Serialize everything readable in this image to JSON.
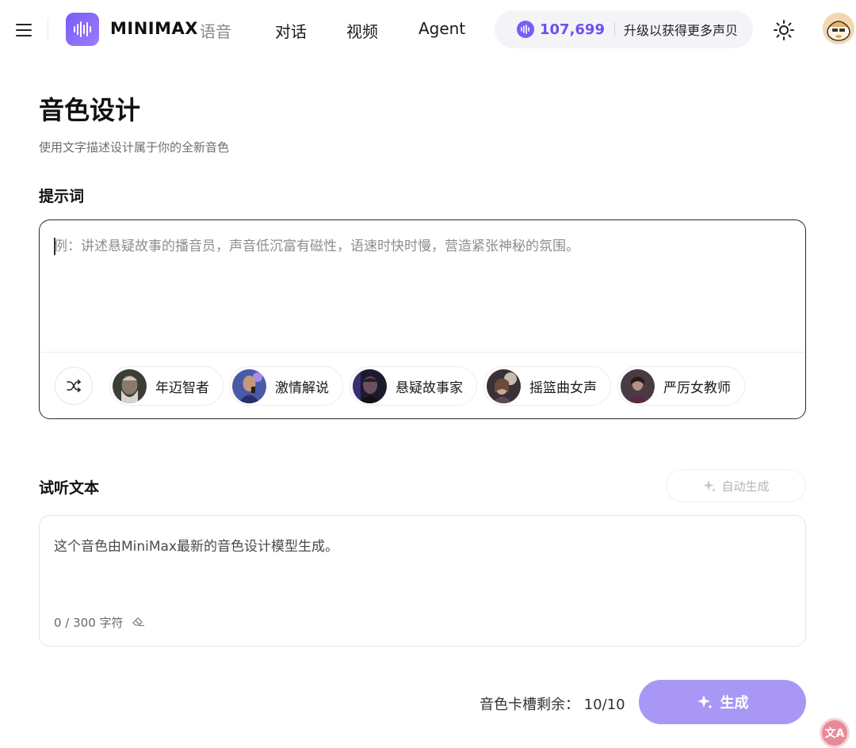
{
  "header": {
    "brand": "MINIMAX",
    "brand_sub": "语音",
    "nav": [
      {
        "label": "对话"
      },
      {
        "label": "视频"
      },
      {
        "label": "Agent"
      }
    ],
    "credits": {
      "value": "107,699",
      "upgrade_label": "升级以获得更多声贝"
    }
  },
  "page": {
    "title": "音色设计",
    "subtitle": "使用文字描述设计属于你的全新音色"
  },
  "prompt": {
    "label": "提示词",
    "placeholder": "例：讲述悬疑故事的播音员，声音低沉富有磁性，语速时快时慢，营造紧张神秘的氛围。",
    "value": "",
    "presets": [
      {
        "label": "年迈智者"
      },
      {
        "label": "激情解说"
      },
      {
        "label": "悬疑故事家"
      },
      {
        "label": "摇篮曲女声"
      },
      {
        "label": "严厉女教师"
      }
    ]
  },
  "preview": {
    "label": "试听文本",
    "auto_label": "自动生成",
    "text": "这个音色由MiniMax最新的音色设计模型生成。",
    "char_count": "0 / 300 字符"
  },
  "footer": {
    "slots_text": "音色卡槽剩余：  10/10",
    "generate_label": "生成"
  },
  "floating": {
    "label": "文A"
  },
  "colors": {
    "accent": "#6f4ef0",
    "generate_button": "#a997f5",
    "logo": "#7b5cf5"
  }
}
